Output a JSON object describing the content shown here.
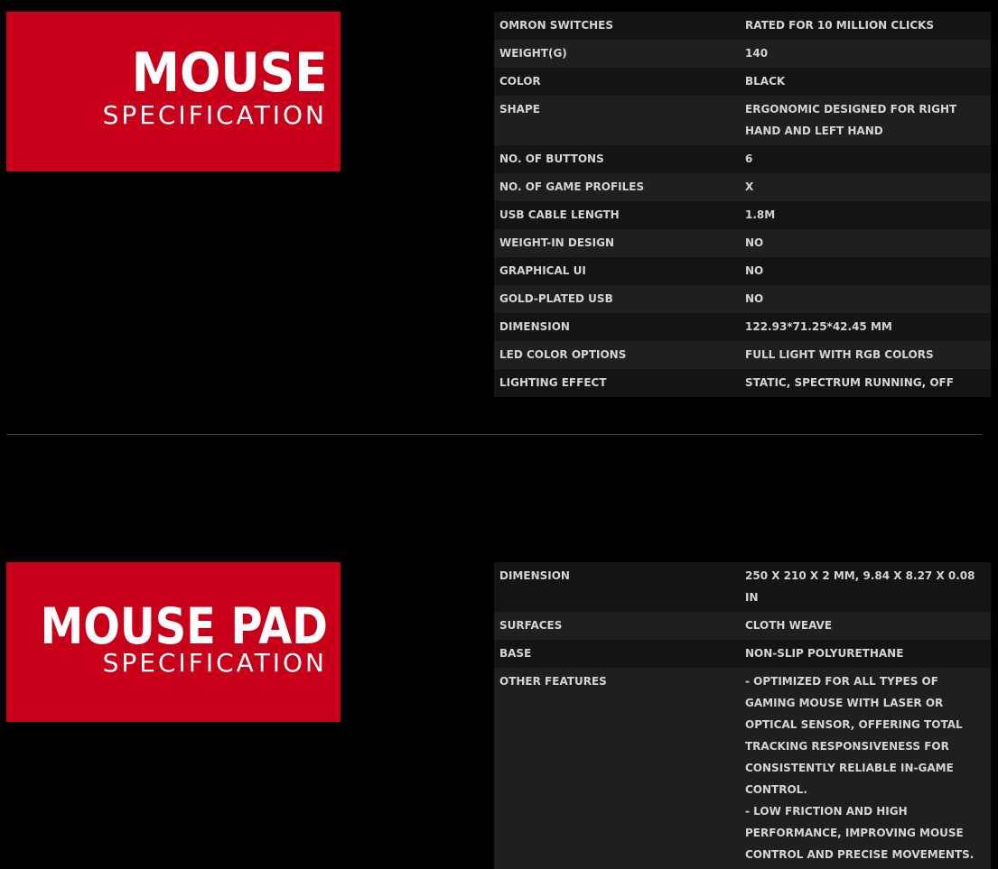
{
  "mouse": {
    "banner": {
      "title": "MOUSE",
      "subtitle": "SPECIFICATION"
    },
    "specs": [
      {
        "key": "OMRON SWITCHES",
        "value": "RATED FOR 10 MILLION CLICKS"
      },
      {
        "key": "WEIGHT(G)",
        "value": "140"
      },
      {
        "key": "COLOR",
        "value": "BLACK"
      },
      {
        "key": "SHAPE",
        "value": "ERGONOMIC DESIGNED FOR RIGHT HAND AND LEFT HAND"
      },
      {
        "key": "NO. OF BUTTONS",
        "value": "6"
      },
      {
        "key": "NO. OF GAME PROFILES",
        "value": "X"
      },
      {
        "key": "USB CABLE LENGTH",
        "value": "1.8M"
      },
      {
        "key": "WEIGHT-IN DESIGN",
        "value": "NO"
      },
      {
        "key": "GRAPHICAL UI",
        "value": "NO"
      },
      {
        "key": "GOLD-PLATED USB",
        "value": "NO"
      },
      {
        "key": "DIMENSION",
        "value": "122.93*71.25*42.45 MM"
      },
      {
        "key": "LED COLOR OPTIONS",
        "value": "FULL LIGHT WITH RGB COLORS"
      },
      {
        "key": "LIGHTING EFFECT",
        "value": "STATIC, SPECTRUM RUNNING, OFF"
      }
    ]
  },
  "mousepad": {
    "banner": {
      "title": "MOUSE PAD",
      "subtitle": "SPECIFICATION"
    },
    "specs": [
      {
        "key": "DIMENSION",
        "value": "250 X 210 X 2 MM, 9.84 X 8.27 X 0.08 IN"
      },
      {
        "key": "SURFACES",
        "value": "CLOTH WEAVE"
      },
      {
        "key": "BASE",
        "value": "NON-SLIP POLYURETHANE"
      },
      {
        "key": "OTHER FEATURES",
        "value": "- OPTIMIZED FOR ALL TYPES OF GAMING MOUSE WITH LASER OR OPTICAL SENSOR, OFFERING TOTAL TRACKING RESPONSIVENESS FOR CONSISTENTLY RELIABLE IN-GAME CONTROL.\n- LOW FRICTION AND HIGH PERFORMANCE, IMPROVING MOUSE CONTROL AND PRECISE MOVEMENTS."
      }
    ]
  },
  "colors": {
    "banner_red": "#c8001a",
    "page_background": "#000000",
    "row_dark": "#141414",
    "row_light": "#1f1f1f",
    "text": "#d4d4d4"
  }
}
